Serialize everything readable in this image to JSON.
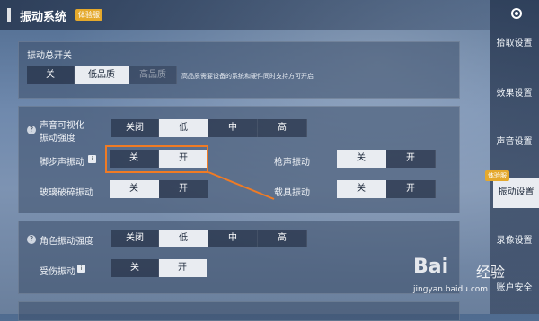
{
  "header": {
    "title": "振动系统",
    "badge": "体验服"
  },
  "master": {
    "label": "振动总开关",
    "options": [
      "关",
      "低品质",
      "高品质"
    ],
    "selected": 1,
    "note": "高品质需要设备的系统和硬件同时支持方可开启"
  },
  "sound_visual": {
    "label_line1": "声音可视化",
    "label_line2": "振动强度",
    "options": [
      "关闭",
      "低",
      "中",
      "高"
    ],
    "selected": 1
  },
  "footstep": {
    "label": "脚步声振动",
    "options": [
      "关",
      "开"
    ],
    "selected": 1
  },
  "gunshot": {
    "label": "枪声振动",
    "options": [
      "关",
      "开"
    ],
    "selected": 0
  },
  "glass": {
    "label": "玻璃破碎振动",
    "options": [
      "关",
      "开"
    ],
    "selected": 0
  },
  "vehicle": {
    "label": "载具振动",
    "options": [
      "关",
      "开"
    ],
    "selected": 0
  },
  "character": {
    "label": "角色振动强度",
    "options": [
      "关闭",
      "低",
      "中",
      "高"
    ],
    "selected": 1
  },
  "hit": {
    "label": "受伤振动",
    "options": [
      "关",
      "开"
    ],
    "selected": 1
  },
  "sidebar": {
    "items": [
      "拾取设置",
      "效果设置",
      "声音设置",
      "振动设置",
      "录像设置",
      "账户安全"
    ],
    "active": 3,
    "badge": "体验服"
  },
  "watermark": {
    "brand": "Bai",
    "brand2": "经验",
    "url": "jingyan.baidu.com"
  }
}
